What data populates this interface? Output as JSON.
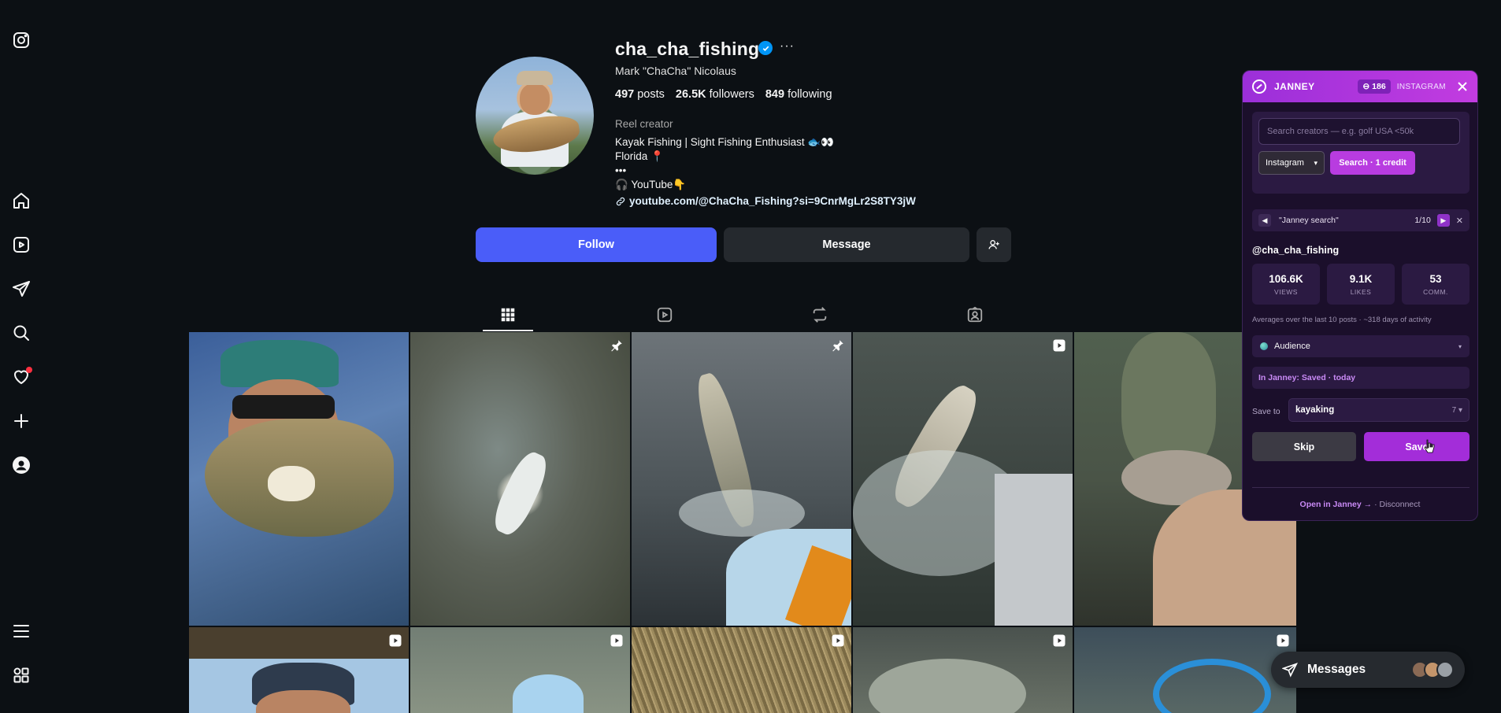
{
  "nav": {
    "items": [
      "instagram-logo",
      "home",
      "reels",
      "messages",
      "search",
      "notifications",
      "create",
      "profile",
      "more",
      "also-from-meta"
    ]
  },
  "profile": {
    "username": "cha_cha_fishing",
    "full_name": "Mark \"ChaCha\" Nicolaus",
    "posts_count": "497",
    "posts_label": "posts",
    "followers_count": "26.5K",
    "followers_label": "followers",
    "following_count": "849",
    "following_label": "following",
    "category": "Reel creator",
    "bio_lines": [
      "Kayak Fishing | Sight Fishing Enthusiast 🐟👀",
      "Florida 📍",
      "•••",
      "🎧 YouTube👇"
    ],
    "link": "youtube.com/@ChaCha_Fishing?si=9CnrMgLr2S8TY3jW",
    "follow_label": "Follow",
    "message_label": "Message"
  },
  "tabs": [
    "posts",
    "reels",
    "reposts",
    "tagged"
  ],
  "janney": {
    "title": "JANNEY",
    "credits": "186",
    "platform": "INSTAGRAM",
    "search_placeholder": "Search creators — e.g. golf USA <50k",
    "platform_select": "Instagram",
    "search_button": "Search · 1 credit",
    "query_label": "\"Janney search\"",
    "counter": "1/10",
    "handle": "@cha_cha_fishing",
    "stats": [
      {
        "value": "106.6K",
        "label": "VIEWS"
      },
      {
        "value": "9.1K",
        "label": "LIKES"
      },
      {
        "value": "53",
        "label": "COMM."
      }
    ],
    "averages_note": "Averages over the last 10 posts · ~318 days of activity",
    "audience_label": "Audience",
    "saved_status": "In Janney: Saved · today",
    "save_to_label": "Save to",
    "save_to_list": "kayaking",
    "save_to_count": "7",
    "skip_label": "Skip",
    "save_label": "Save",
    "open_link": "Open in Janney →",
    "separator": " · ",
    "disconnect": "Disconnect"
  },
  "messages_pill": {
    "label": "Messages"
  },
  "colors": {
    "background": "#0c1014",
    "follow_button": "#4a5df9",
    "janney_accent": "#b83ce0",
    "verified": "#0095f6"
  }
}
